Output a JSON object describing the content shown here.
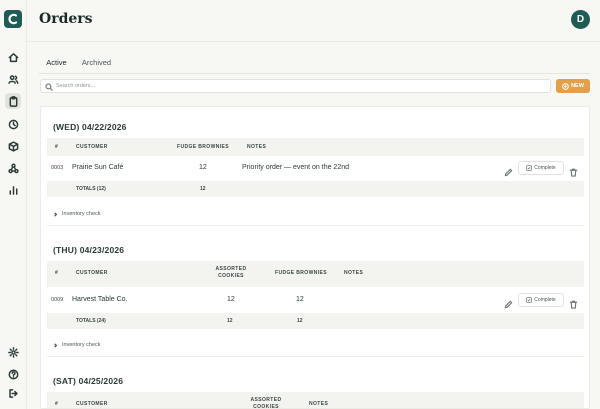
{
  "app": {
    "title": "Orders",
    "avatar_initial": "D"
  },
  "sidebar": {
    "items": [
      {
        "name": "home-icon"
      },
      {
        "name": "users-icon"
      },
      {
        "name": "clipboard-icon",
        "active": true
      },
      {
        "name": "clock-icon"
      },
      {
        "name": "box-icon"
      },
      {
        "name": "workflow-icon"
      },
      {
        "name": "chart-icon"
      }
    ],
    "bottom": [
      {
        "name": "settings-icon"
      },
      {
        "name": "help-icon"
      },
      {
        "name": "logout-icon"
      }
    ]
  },
  "tabs": [
    {
      "label": "Active",
      "active": true
    },
    {
      "label": "Archived",
      "active": false
    }
  ],
  "search": {
    "placeholder": "Search orders..."
  },
  "toolbar": {
    "new_label": "NEW"
  },
  "groups": [
    {
      "title": "(WED) 04/22/2026",
      "headers": {
        "num": "#",
        "customer": "CUSTOMER",
        "col1": "FUDGE BROWNIES",
        "notes": "NOTES"
      },
      "row": {
        "id": "0003",
        "customer": "Prairie Sun Café",
        "col1": "12",
        "notes": "Priority order — event on the 22nd",
        "complete": "Complete"
      },
      "totals": {
        "label": "TOTALS (12)",
        "col1": "12"
      },
      "inventory": "Inventory check"
    },
    {
      "title": "(THU) 04/23/2026",
      "headers": {
        "num": "#",
        "customer": "CUSTOMER",
        "col1": "ASSORTED COOKIES",
        "col2": "FUDGE BROWNIES",
        "notes": "NOTES"
      },
      "row": {
        "id": "0009",
        "customer": "Harvest Table Co.",
        "col1": "12",
        "col2": "12",
        "notes": "",
        "complete": "Complete"
      },
      "totals": {
        "label": "TOTALS (24)",
        "col1": "12",
        "col2": "12"
      },
      "inventory": "Inventory check"
    },
    {
      "title": "(SAT) 04/25/2026",
      "headers": {
        "num": "#",
        "customer": "CUSTOMER",
        "col1": "ASSORTED COOKIES",
        "notes": "NOTES"
      }
    }
  ],
  "colors": {
    "brand": "#1f5c53",
    "accent": "#e3a04a"
  }
}
